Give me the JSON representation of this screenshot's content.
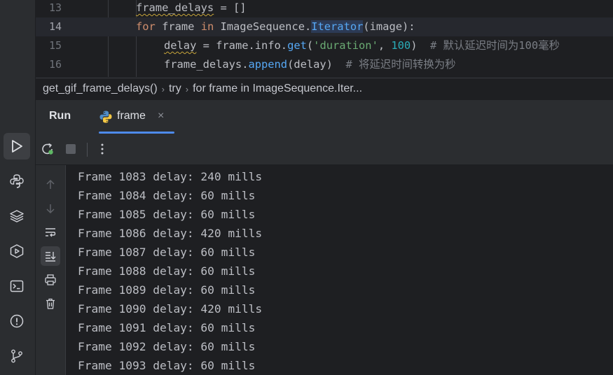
{
  "editor": {
    "lines": [
      {
        "num": "13",
        "parts": [
          {
            "t": "frame_delays",
            "c": "squig"
          },
          {
            "t": " = []",
            "c": ""
          }
        ]
      },
      {
        "num": "14",
        "parts": [
          {
            "t": "for",
            "c": "kw"
          },
          {
            "t": " frame ",
            "c": ""
          },
          {
            "t": "in",
            "c": "kw"
          },
          {
            "t": " ImageSequence.",
            "c": ""
          },
          {
            "t": "Iterator",
            "c": "hl"
          },
          {
            "t": "(image):",
            "c": ""
          }
        ]
      },
      {
        "num": "15",
        "parts": [
          {
            "t": "delay",
            "c": "squig"
          },
          {
            "t": " = frame.info.",
            "c": ""
          },
          {
            "t": "get",
            "c": "fn"
          },
          {
            "t": "(",
            "c": ""
          },
          {
            "t": "'duration'",
            "c": "str"
          },
          {
            "t": ", ",
            "c": ""
          },
          {
            "t": "100",
            "c": "num"
          },
          {
            "t": ")  ",
            "c": ""
          },
          {
            "t": "# 默认延迟时间为100毫秒",
            "c": "cmt"
          }
        ]
      },
      {
        "num": "16",
        "parts": [
          {
            "t": "frame_delays.",
            "c": ""
          },
          {
            "t": "append",
            "c": "fn"
          },
          {
            "t": "(delay)  ",
            "c": ""
          },
          {
            "t": "# 将延迟时间转换为秒",
            "c": "cmt"
          }
        ]
      }
    ],
    "current_line": "14"
  },
  "breadcrumb": [
    "get_gif_frame_delays()",
    "try",
    "for frame in ImageSequence.Iter..."
  ],
  "run_panel": {
    "title": "Run",
    "tab_label": "frame",
    "tab_close": "×"
  },
  "console": {
    "lines": [
      "Frame 1083 delay: 240 mills",
      "Frame 1084 delay: 60 mills",
      "Frame 1085 delay: 60 mills",
      "Frame 1086 delay: 420 mills",
      "Frame 1087 delay: 60 mills",
      "Frame 1088 delay: 60 mills",
      "Frame 1089 delay: 60 mills",
      "Frame 1090 delay: 420 mills",
      "Frame 1091 delay: 60 mills",
      "Frame 1092 delay: 60 mills",
      "Frame 1093 delay: 60 mills"
    ]
  },
  "activity_bar": {
    "icons": [
      "run-icon",
      "python-console-icon",
      "layers-icon",
      "services-icon",
      "terminal-icon",
      "problems-icon",
      "git-icon"
    ],
    "active": "run-icon"
  },
  "toolbar": {
    "icons": [
      "rerun-icon",
      "stop-icon",
      "more-options-icon"
    ]
  },
  "console_side": {
    "icons": [
      "scroll-up-icon",
      "scroll-down-icon",
      "soft-wrap-icon",
      "scroll-to-end-icon",
      "print-icon",
      "clear-all-icon"
    ],
    "active": "scroll-to-end-icon"
  },
  "colors": {
    "accent": "#4e8aea",
    "keyword": "#cf8e6d",
    "string": "#6aab73",
    "number": "#2aacb8",
    "function": "#56a8f5",
    "comment": "#7a7e85"
  }
}
